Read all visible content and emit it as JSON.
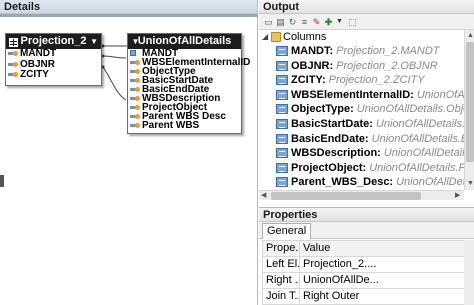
{
  "details": {
    "title": "Details",
    "nodes": [
      {
        "title": "Projection_2",
        "fields": [
          "MANDT",
          "OBJNR",
          "ZCITY"
        ]
      },
      {
        "title": "UnionOfAllDetails",
        "fields": [
          "MANDT",
          "WBSElementInternalID",
          "ObjectType",
          "BasicStartDate",
          "BasicEndDate",
          "WBSDescription",
          "ProjectObject",
          "Parent WBS Desc",
          "Parent WBS"
        ]
      }
    ]
  },
  "output": {
    "title": "Output",
    "folder": "Columns",
    "columns": [
      {
        "name": "MANDT:",
        "source": "Projection_2.MANDT"
      },
      {
        "name": "OBJNR:",
        "source": "Projection_2.OBJNR"
      },
      {
        "name": "ZCITY:",
        "source": "Projection_2.ZCITY"
      },
      {
        "name": "WBSElementInternalID:",
        "source": "UnionOfAllDet"
      },
      {
        "name": "ObjectType:",
        "source": "UnionOfAllDetails.ObjectTyp"
      },
      {
        "name": "BasicStartDate:",
        "source": "UnionOfAllDetails.BasicSt"
      },
      {
        "name": "BasicEndDate:",
        "source": "UnionOfAllDetails.BasicEn"
      },
      {
        "name": "WBSDescription:",
        "source": "UnionOfAllDetails.WBS"
      },
      {
        "name": "ProjectObject:",
        "source": "UnionOfAllDetails.Projecti"
      },
      {
        "name": "Parent_WBS_Desc:",
        "source": "UnionOfAllDetails.Pa"
      }
    ]
  },
  "properties": {
    "title": "Properties",
    "tab": "General",
    "rows": [
      {
        "key": "Prope...",
        "value": "Value"
      },
      {
        "key": "Left El...",
        "value": "Projection_2...."
      },
      {
        "key": "Right ...",
        "value": "UnionOfAllDe..."
      },
      {
        "key": "Join T...",
        "value": "Right Outer"
      }
    ]
  },
  "colors": {
    "node_header": "#1d1d1d",
    "key_dot": "#f19a25",
    "join_line": "#444444"
  }
}
